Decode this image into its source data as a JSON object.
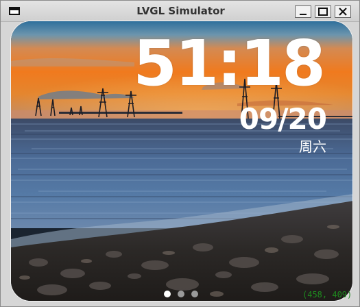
{
  "window": {
    "title": "LVGL Simulator",
    "controls": [
      "minimize",
      "maximize",
      "close"
    ]
  },
  "clock": {
    "time": "51:18",
    "date": "09/20",
    "weekday": "周六"
  },
  "pager": {
    "pages": 3,
    "active_index": 0
  },
  "status": {
    "pointer_coords": "(458, 409)"
  },
  "colors": {
    "time_text": "#ffffff",
    "coords_text": "#1e8a1e",
    "dot_active": "#ffffff",
    "dot_inactive": "#9a9a9a"
  },
  "icons": {
    "app": "window-icon",
    "minimize": "minimize-icon",
    "maximize": "maximize-icon",
    "close": "close-icon"
  }
}
